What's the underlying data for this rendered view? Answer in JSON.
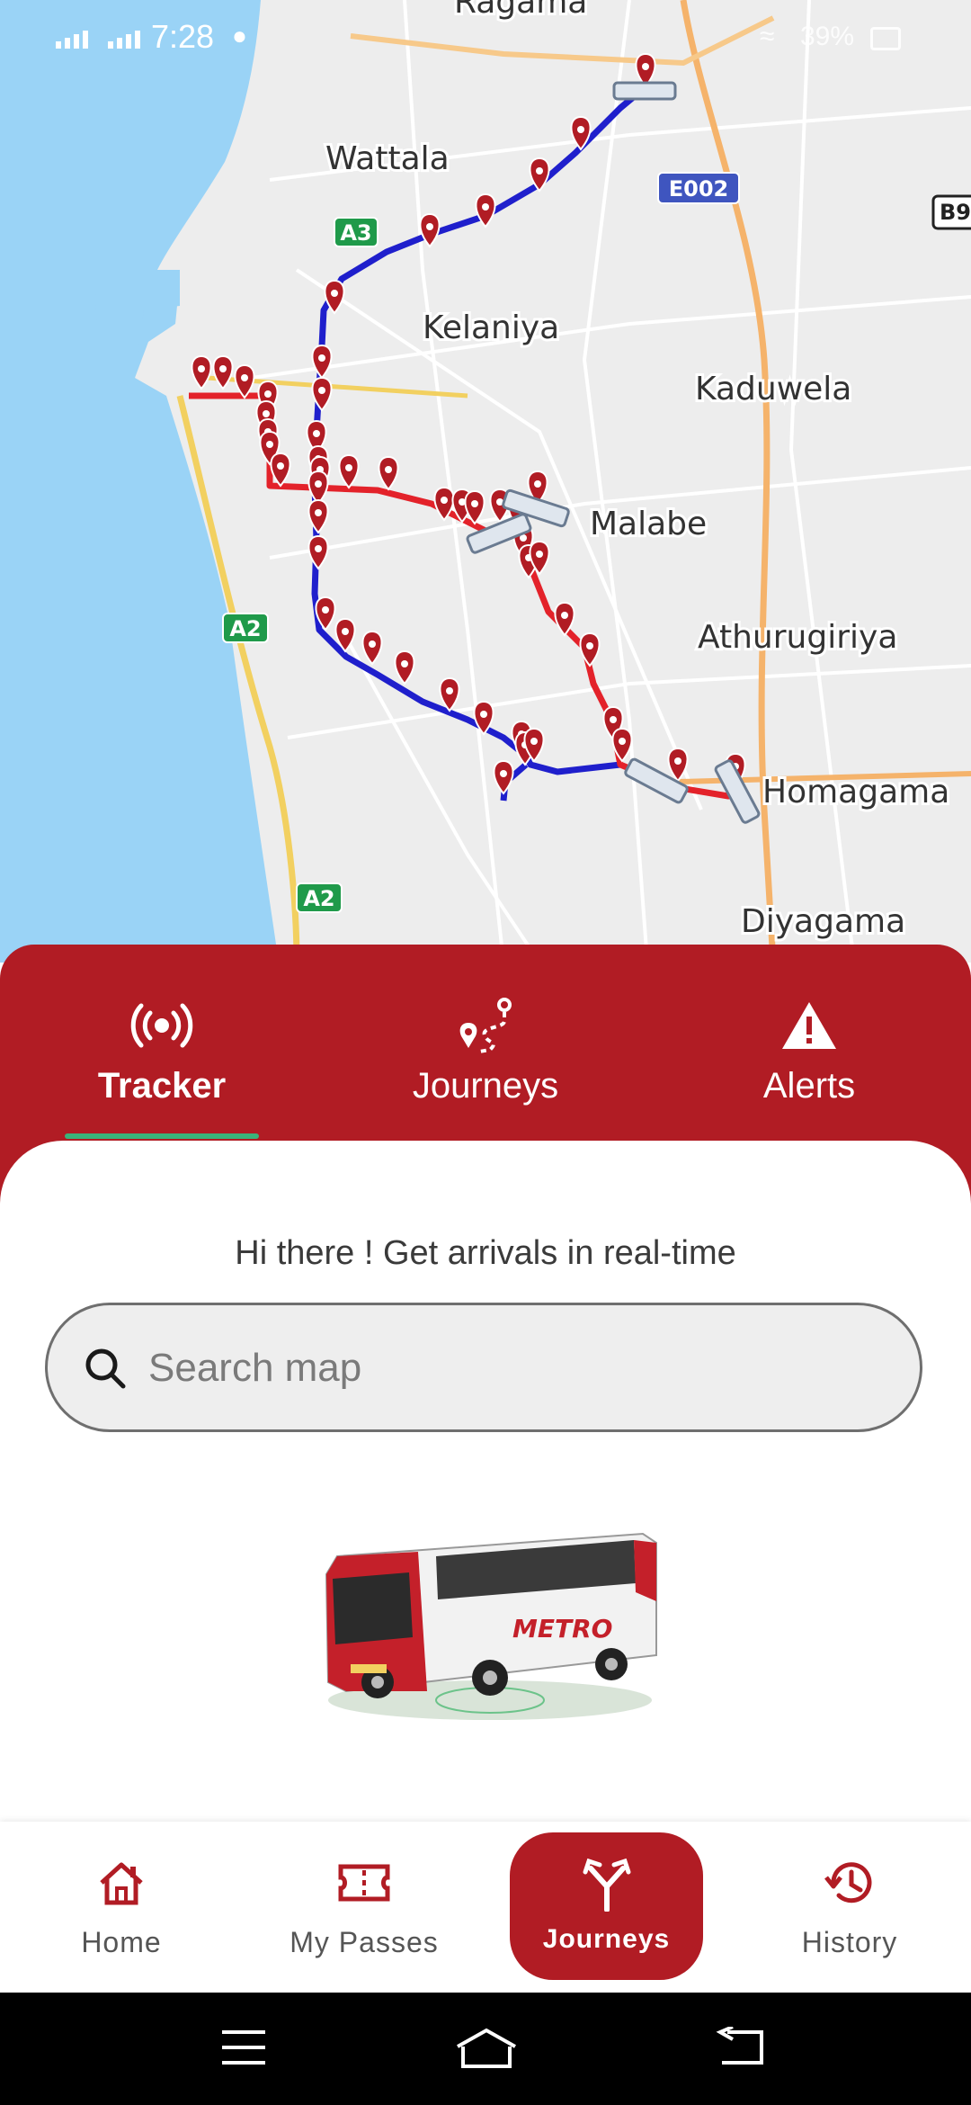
{
  "status_bar": {
    "time": "7:28",
    "battery": "39%"
  },
  "map": {
    "places": [
      "Ragama",
      "Wattala",
      "Kelaniya",
      "Kaduwela",
      "Malabe",
      "Athurugiriya",
      "Homagama",
      "Diyagama"
    ],
    "road_shields": [
      "A3",
      "E002",
      "A2",
      "A2",
      "B9"
    ],
    "routes": [
      {
        "name": "blue-route",
        "color": "#1f1fcc"
      },
      {
        "name": "red-route",
        "color": "#e3222a"
      }
    ],
    "stop_color": "#b11c24"
  },
  "tabs": [
    {
      "label": "Tracker",
      "icon": "broadcast-icon",
      "active": true
    },
    {
      "label": "Journeys",
      "icon": "route-pin-icon",
      "active": false
    },
    {
      "label": "Alerts",
      "icon": "warning-icon",
      "active": false
    }
  ],
  "greeting": "Hi there ! Get arrivals in real-time",
  "search": {
    "placeholder": "Search map",
    "value": ""
  },
  "bottom_nav": [
    {
      "label": "Home",
      "icon": "home-icon",
      "active": false
    },
    {
      "label": "My Passes",
      "icon": "ticket-icon",
      "active": false
    },
    {
      "label": "Journeys",
      "icon": "fork-arrow-icon",
      "active": true
    },
    {
      "label": "History",
      "icon": "history-icon",
      "active": false
    }
  ],
  "colors": {
    "brand": "#b11c24",
    "indicator": "#3ab37a"
  }
}
